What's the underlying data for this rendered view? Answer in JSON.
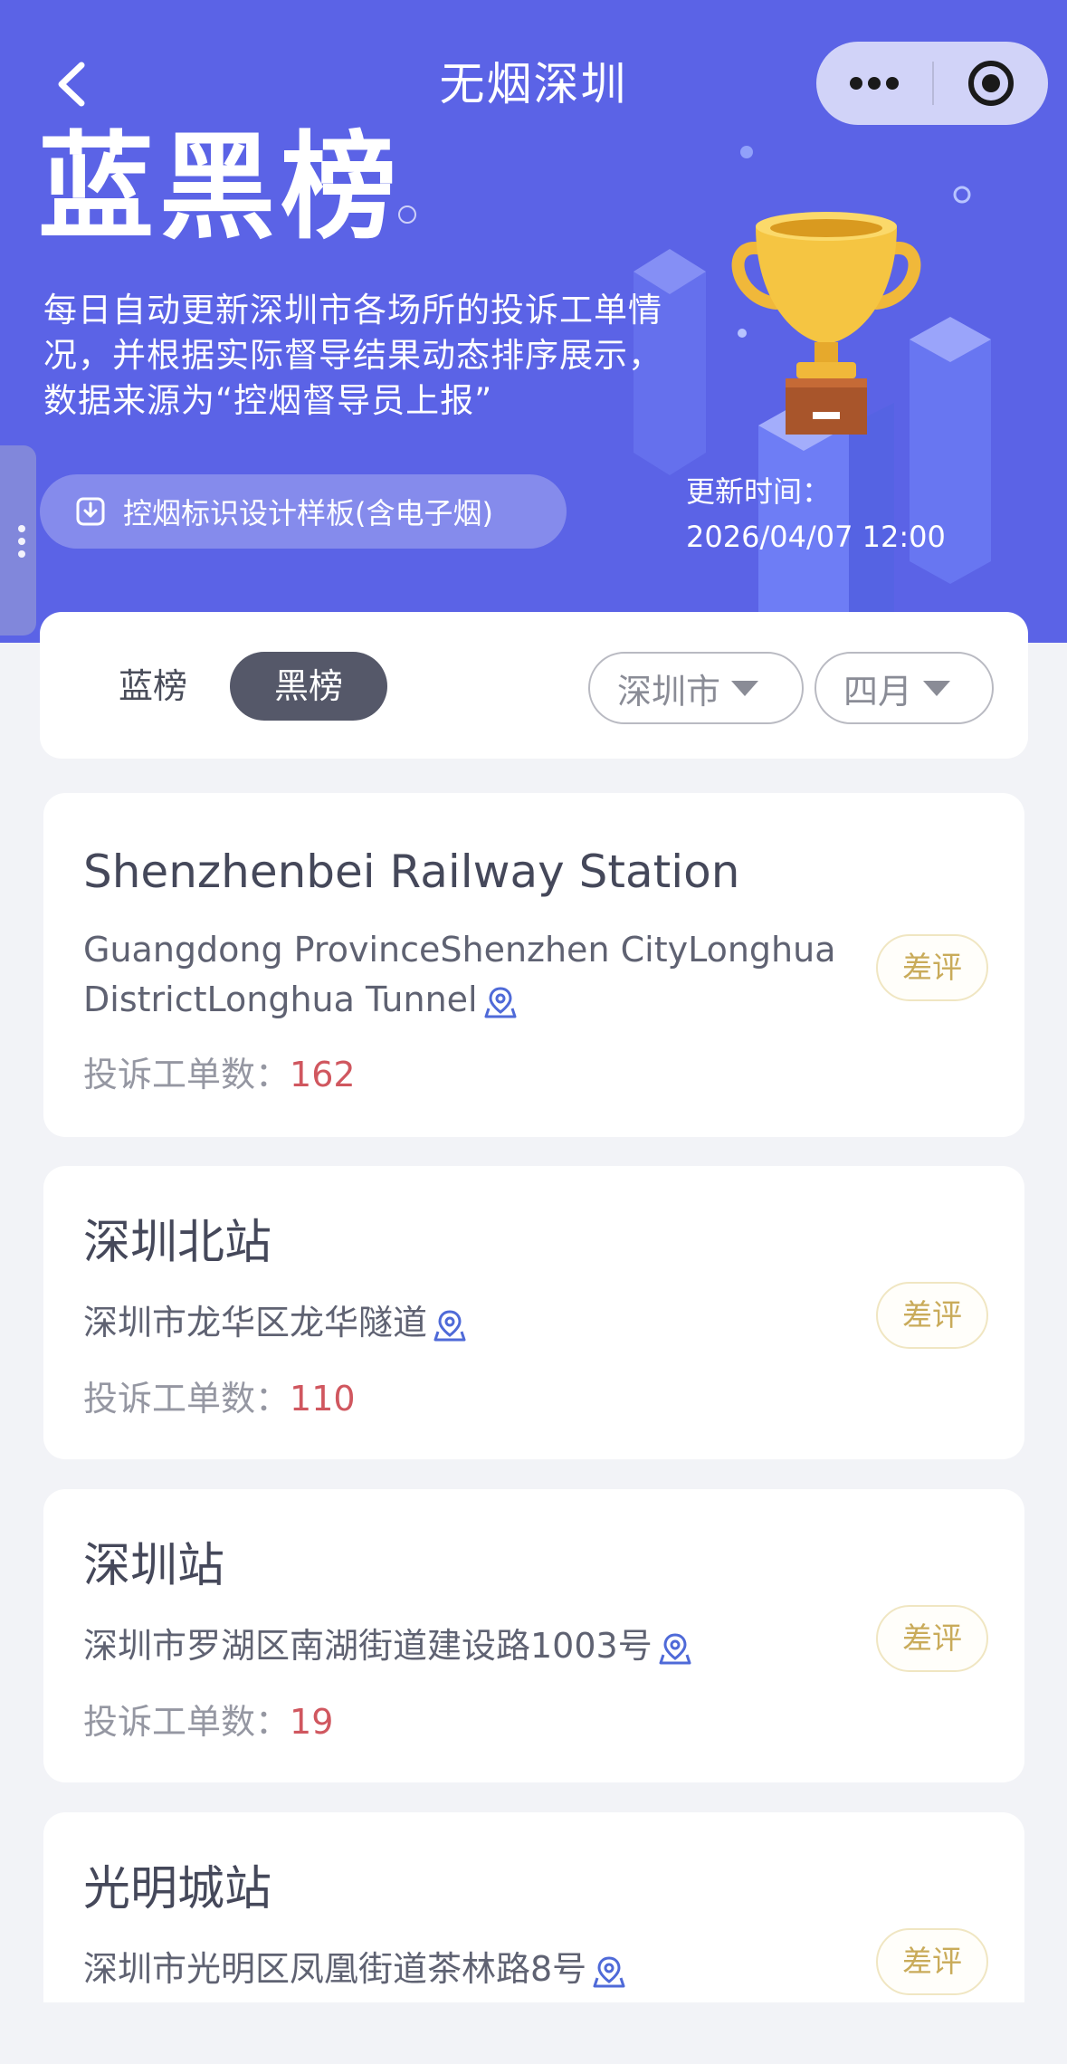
{
  "nav": {
    "title": "无烟深圳"
  },
  "hero": {
    "big_title": "蓝黑榜",
    "description": "每日自动更新深圳市各场所的投诉工单情况，并根据实际督导结果动态排序展示，数据来源为“控烟督导员上报”",
    "template_button_label": "控烟标识设计样板(含电子烟)",
    "update_label": "更新时间：",
    "update_time": "2026/04/07 12:00"
  },
  "filters": {
    "tabs": [
      {
        "label": "蓝榜",
        "active": false
      },
      {
        "label": "黑榜",
        "active": true
      }
    ],
    "city": "深圳市",
    "month": "四月"
  },
  "list": [
    {
      "name": "Shenzhenbei Railway Station",
      "address": "Guangdong ProvinceShenzhen CityLonghua DistrictLonghua Tunnel",
      "count_label": "投诉工单数：",
      "count": "162",
      "badge": "差评"
    },
    {
      "name": "深圳北站",
      "address": "深圳市龙华区龙华隧道",
      "count_label": "投诉工单数：",
      "count": "110",
      "badge": "差评"
    },
    {
      "name": "深圳站",
      "address": "深圳市罗湖区南湖街道建设路1003号",
      "count_label": "投诉工单数：",
      "count": "19",
      "badge": "差评"
    },
    {
      "name": "光明城站",
      "address": "深圳市光明区凤凰街道茶林路8号",
      "badge": "差评"
    }
  ],
  "colors": {
    "hero_bg": "#5b63e6",
    "page_bg": "#f2f3f7",
    "active_tab_bg": "#555869",
    "count_red": "#d0575f",
    "badge_gold": "#c9ab5a",
    "pin_blue": "#4f6ad8"
  },
  "icons": [
    "back-arrow-icon",
    "more-dots-icon",
    "mini-program-close-icon",
    "download-icon",
    "trophy-illustration",
    "dropdown-triangle-icon",
    "location-pin-icon"
  ]
}
